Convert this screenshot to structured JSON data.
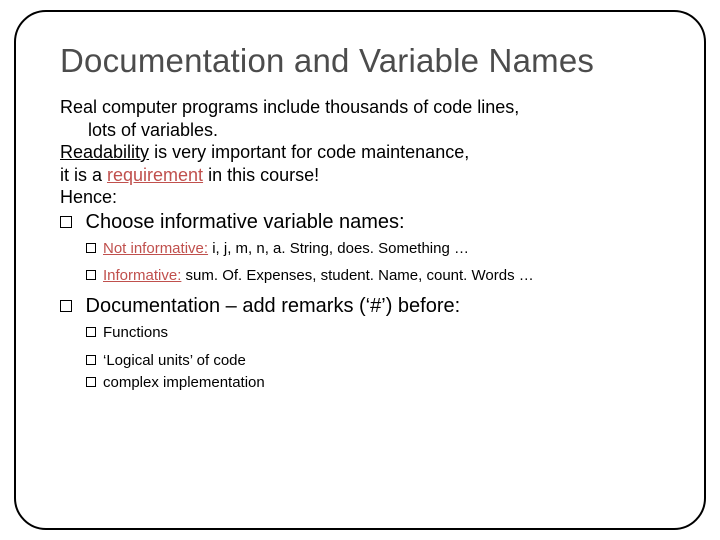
{
  "title": "Documentation and Variable Names",
  "p1_a": "Real computer programs include thousands of code lines,",
  "p1_b": "lots of variables.",
  "p2_a": "Readability",
  "p2_b": " is very important for code maintenance,",
  "p3_a": "it is a ",
  "p3_b": "requirement",
  "p3_c": " in this course!",
  "p4": "Hence:",
  "b1": " Choose informative variable names:",
  "s1_a": "Not informative:",
  "s1_b": " i, j, m, n, a. String, does. Something …",
  "s2_a": "Informative:",
  "s2_b": " sum. Of. Expenses, student. Name, count. Words …",
  "b2": " Documentation – add remarks (‘#’) before:",
  "s3": "Functions",
  "s4": "‘Logical units’ of code",
  "s5": "complex implementation"
}
